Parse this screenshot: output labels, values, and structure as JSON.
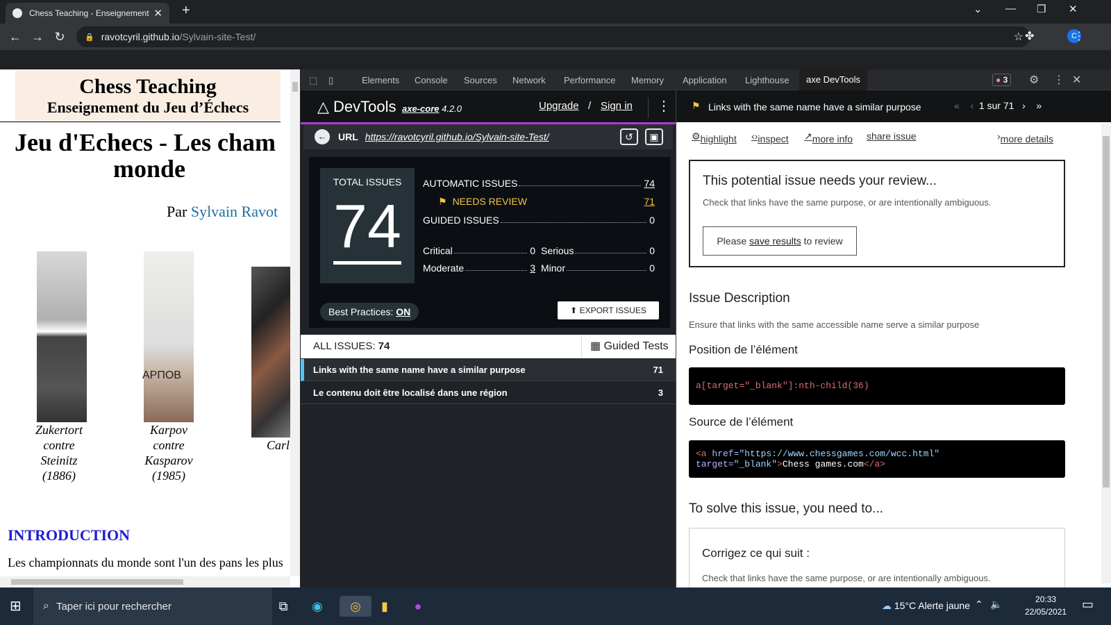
{
  "browser": {
    "tab_title": "Chess Teaching - Enseignement d",
    "url_host": "ravotcyril.github.io",
    "url_path": "/Sylvain-site-Test/",
    "avatar_letter": "C"
  },
  "page": {
    "banner_line1": "Chess Teaching",
    "banner_line2": "Enseignement du Jeu d’Échecs",
    "title_line1": "Jeu d'Echecs - Les cham",
    "title_line2": "monde",
    "author_prefix": "Par ",
    "author_name": "Sylvain Ravot",
    "captions": [
      "Zukertort\ncontre\nSteinitz\n(1886)",
      "Karpov\ncontre\nKasparov\n(1985)",
      "Carl"
    ],
    "photo2_text": "АРПОВ",
    "intro_heading": "INTRODUCTION",
    "intro_text": "Les championnats du monde sont l'un des pans les plus"
  },
  "devtools": {
    "tabs": [
      "Elements",
      "Console",
      "Sources",
      "Network",
      "Performance",
      "Memory",
      "Application",
      "Lighthouse",
      "axe DevTools"
    ],
    "active_tab": "axe DevTools",
    "error_count": "3"
  },
  "axe": {
    "product": "DevTools",
    "core_label": "axe-core",
    "core_version": "4.2.0",
    "upgrade": "Upgrade",
    "slash": "/",
    "sign_in": "Sign in",
    "url_label": "URL",
    "url": "https://ravotcyril.github.io/Sylvain-site-Test/",
    "total_label": "TOTAL ISSUES",
    "total": "74",
    "automatic_label": "AUTOMATIC ISSUES",
    "automatic": "74",
    "needs_review_label": "NEEDS REVIEW",
    "needs_review": "71",
    "guided_label": "GUIDED ISSUES",
    "guided": "0",
    "critical_label": "Critical",
    "critical": "0",
    "serious_label": "Serious",
    "serious": "0",
    "moderate_label": "Moderate",
    "moderate": "3",
    "minor_label": "Minor",
    "minor": "0",
    "best_practices_label": "Best Practices: ",
    "best_practices_value": "ON",
    "export_label": "EXPORT ISSUES",
    "all_issues_label": "ALL ISSUES: ",
    "all_issues_count": "74",
    "guided_tests": "Guided Tests",
    "issues": [
      {
        "label": "Links with the same name have a similar purpose",
        "count": "71"
      },
      {
        "label": "Le contenu doit être localisé dans une région",
        "count": "3"
      }
    ]
  },
  "detail": {
    "title": "Links with the same name have a similar purpose",
    "pager": "1 sur 71",
    "highlight": "highlight",
    "inspect": "inspect",
    "more_info": "more info",
    "share_issue": "share issue",
    "more_details": "more details",
    "review_heading": "This potential issue needs your review...",
    "review_text": "Check that links have the same purpose, or are intentionally ambiguous.",
    "review_btn_pre": "Please ",
    "review_btn_link": "save results",
    "review_btn_post": " to review",
    "desc_heading": "Issue Description",
    "desc_text": "Ensure that links with the same accessible name serve a similar purpose",
    "position_heading": "Position de l’élément",
    "selector": "a[target=\"_blank\"]:nth-child(36)",
    "source_heading": "Source de l’élément",
    "source_tag_open": "<a",
    "source_href_attr": " href=",
    "source_href_val": "\"https://www.chessgames.com/wcc.html\"",
    "source_target_attr": " target=",
    "source_target_val": "\"_blank\"",
    "source_close": ">",
    "source_text": "Chess games.com",
    "source_end": "</a>",
    "solve_heading": "To solve this issue, you need to...",
    "fix_heading": "Corrigez ce qui suit :",
    "fix_text": "Check that links have the same purpose, or are intentionally ambiguous."
  },
  "taskbar": {
    "search_placeholder": "Taper ici pour rechercher",
    "weather": "15°C  Alerte jaune",
    "time": "20:33",
    "date": "22/05/2021"
  },
  "colors": {
    "accent_purple": "#b13ad6",
    "review_yellow": "#f6c344",
    "selected_issue_bar": "#4fc3f7",
    "link_blue": "#1f6ea3"
  }
}
